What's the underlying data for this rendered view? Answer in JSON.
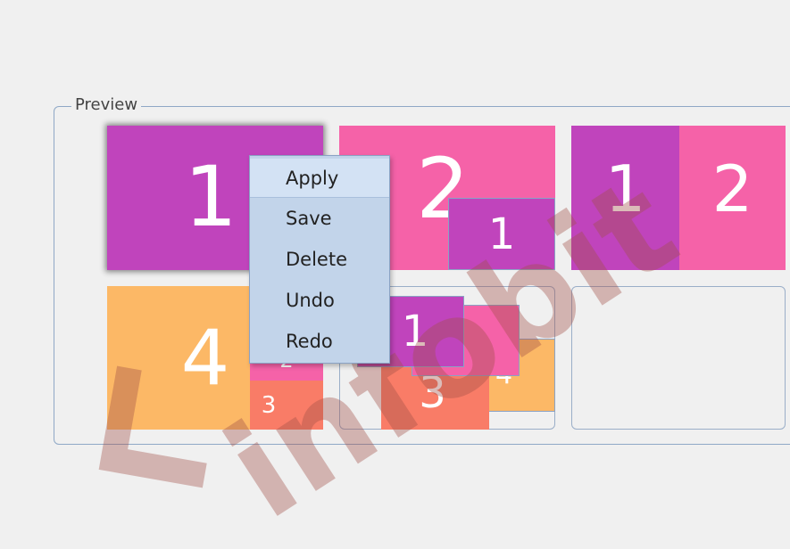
{
  "preview": {
    "legend": "Preview",
    "layouts": [
      {
        "blocks": [
          "1"
        ]
      },
      {
        "blocks": [
          "2",
          "1"
        ]
      },
      {
        "blocks": [
          "1",
          "2"
        ]
      },
      {
        "blocks": [
          "4",
          "2",
          "3"
        ]
      },
      {
        "blocks": [
          "1",
          "2",
          "3",
          "4"
        ]
      },
      {
        "blocks": []
      }
    ]
  },
  "context_menu": {
    "items": [
      {
        "label": "Apply",
        "highlighted": true
      },
      {
        "label": "Save"
      },
      {
        "label": "Delete"
      },
      {
        "label": "Undo"
      },
      {
        "label": "Redo"
      }
    ]
  },
  "watermark": {
    "text": "infobit"
  },
  "colors": {
    "purple": "#c044bc",
    "pink": "#f562a8",
    "orange": "#fcb866",
    "salmon": "#f97c67",
    "menu": "#c2d4ea",
    "border": "#8aa2c4"
  }
}
